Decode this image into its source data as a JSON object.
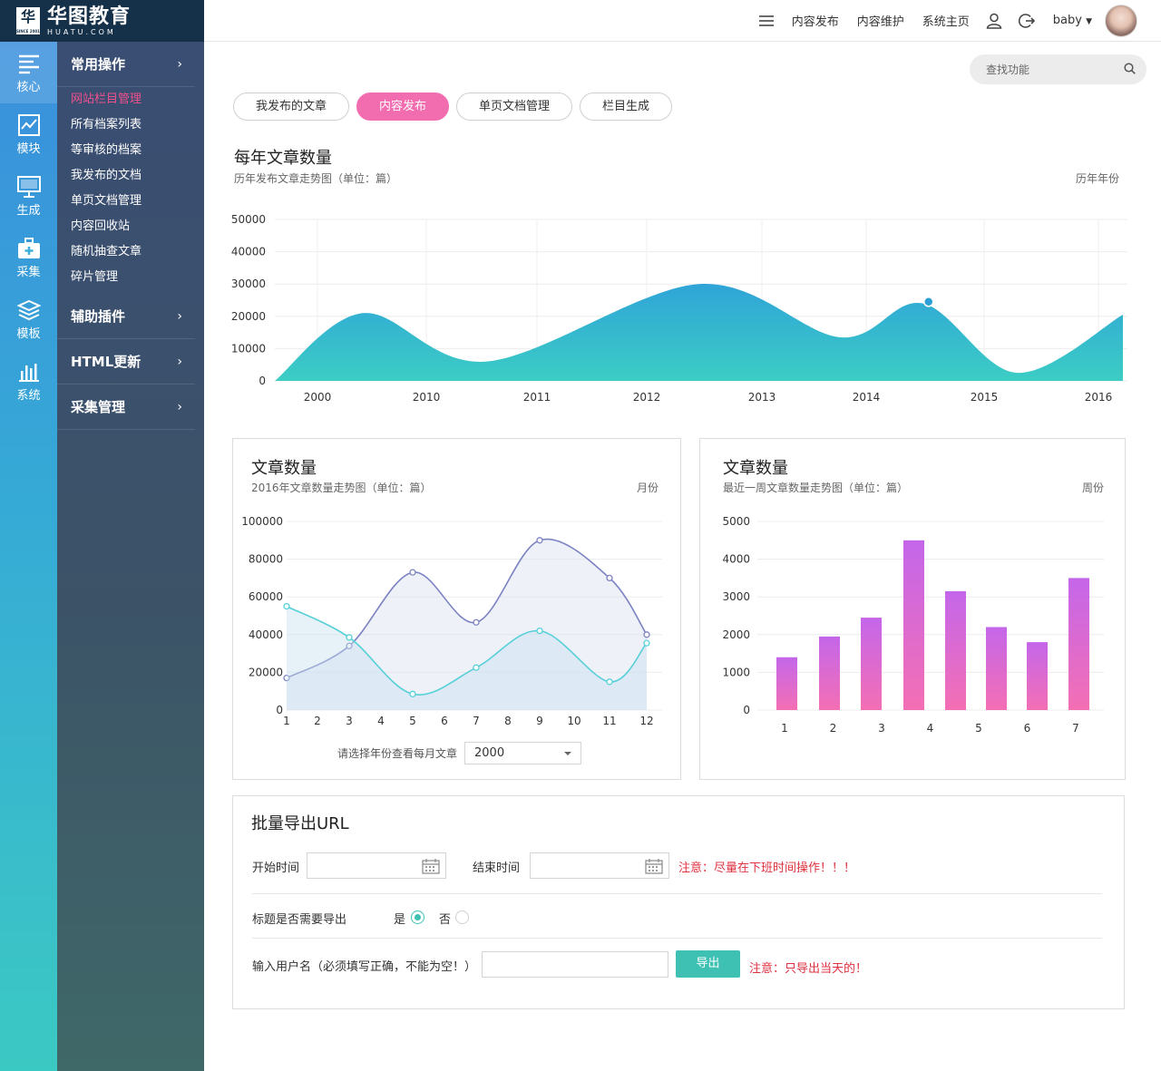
{
  "logo": {
    "cn": "华图教育",
    "en": "HUATU.COM",
    "mark": "华",
    "since": "SINCE 2001"
  },
  "rail": [
    {
      "label": "核心",
      "icon": "menu-lines-icon"
    },
    {
      "label": "模块",
      "icon": "trend-chart-icon"
    },
    {
      "label": "生成",
      "icon": "monitor-icon"
    },
    {
      "label": "采集",
      "icon": "medkit-icon"
    },
    {
      "label": "模板",
      "icon": "layers-icon"
    },
    {
      "label": "系统",
      "icon": "bar-stats-icon"
    }
  ],
  "submenu": {
    "group1": "常用操作",
    "items": [
      "网站栏目管理",
      "所有档案列表",
      "等审核的档案",
      "我发布的文档",
      "单页文档管理",
      "内容回收站",
      "随机抽查文章",
      "碎片管理"
    ],
    "group2": "辅助插件",
    "group3": "HTML更新",
    "group4": "采集管理",
    "chevron": "›"
  },
  "topbar": {
    "links": [
      "内容发布",
      "内容维护",
      "系统主页"
    ],
    "user": "baby"
  },
  "search": {
    "placeholder": "查找功能"
  },
  "tabs": [
    "我发布的文章",
    "内容发布",
    "单页文档管理",
    "栏目生成"
  ],
  "yearly": {
    "title": "每年文章数量",
    "subtitle": "历年发布文章走势图（单位：篇）",
    "right": "历年年份"
  },
  "monthly": {
    "title": "文章数量",
    "subtitle": "2016年文章数量走势图（单位：篇）",
    "right": "月份",
    "select_label": "请选择年份查看每月文章",
    "select_value": "2000"
  },
  "weekly": {
    "title": "文章数量",
    "subtitle": "最近一周文章数量走势图（单位：篇）",
    "right": "周份"
  },
  "export": {
    "title": "批量导出URL",
    "start_label": "开始时间",
    "end_label": "结束时间",
    "warn1": "注意：尽量在下班时间操作！！！",
    "title_q": "标题是否需要导出",
    "yes": "是",
    "no": "否",
    "user_label": "输入用户名（必须填写正确，不能为空！）",
    "button": "导出",
    "warn2": "注意：只导出当天的！"
  },
  "colors": {
    "accent_pink": "#f26db0",
    "teal": "#3ec1b2",
    "warn_red": "#e0313f"
  },
  "chart_data": [
    {
      "type": "area",
      "categories": [
        "2000",
        "2010",
        "2011",
        "2012",
        "2013",
        "2014",
        "2015",
        "2016"
      ],
      "values": [
        21000,
        6000,
        30000,
        14000,
        24000,
        2000,
        20500
      ],
      "x_note": "smoothed area; peaks read from gridlines",
      "points": [
        {
          "x": 0.0,
          "y": 0
        },
        {
          "x": 0.75,
          "y": 21000
        },
        {
          "x": 1.8,
          "y": 6000
        },
        {
          "x": 3.6,
          "y": 30000
        },
        {
          "x": 4.8,
          "y": 13500
        },
        {
          "x": 5.5,
          "y": 24000
        },
        {
          "x": 6.3,
          "y": 2500
        },
        {
          "x": 7.2,
          "y": 20500
        }
      ],
      "highlight": {
        "x": 5.55,
        "y": 24500
      },
      "yticks": [
        0,
        10000,
        20000,
        30000,
        40000,
        50000
      ],
      "ylim": [
        0,
        50000
      ]
    },
    {
      "type": "line",
      "categories": [
        "1",
        "2",
        "3",
        "4",
        "5",
        "6",
        "7",
        "8",
        "9",
        "10",
        "11",
        "12"
      ],
      "series": [
        {
          "values": [
            17000,
            null,
            34000,
            null,
            73000,
            null,
            46500,
            null,
            90000,
            null,
            70000,
            40000
          ],
          "color": "#7b82c2"
        },
        {
          "values": [
            55000,
            null,
            38500,
            null,
            8500,
            null,
            22500,
            null,
            42000,
            null,
            15000,
            35500
          ],
          "color": "#56d0d8"
        }
      ],
      "yticks": [
        0,
        20000,
        40000,
        60000,
        80000,
        100000
      ],
      "ylim": [
        0,
        100000
      ]
    },
    {
      "type": "bar",
      "categories": [
        "1",
        "2",
        "3",
        "4",
        "5",
        "6",
        "7"
      ],
      "values": [
        1400,
        1950,
        2450,
        4500,
        3150,
        2200,
        1800,
        3500
      ],
      "yticks": [
        0,
        1000,
        2000,
        3000,
        4000,
        5000
      ],
      "ylim": [
        0,
        5000
      ]
    }
  ]
}
